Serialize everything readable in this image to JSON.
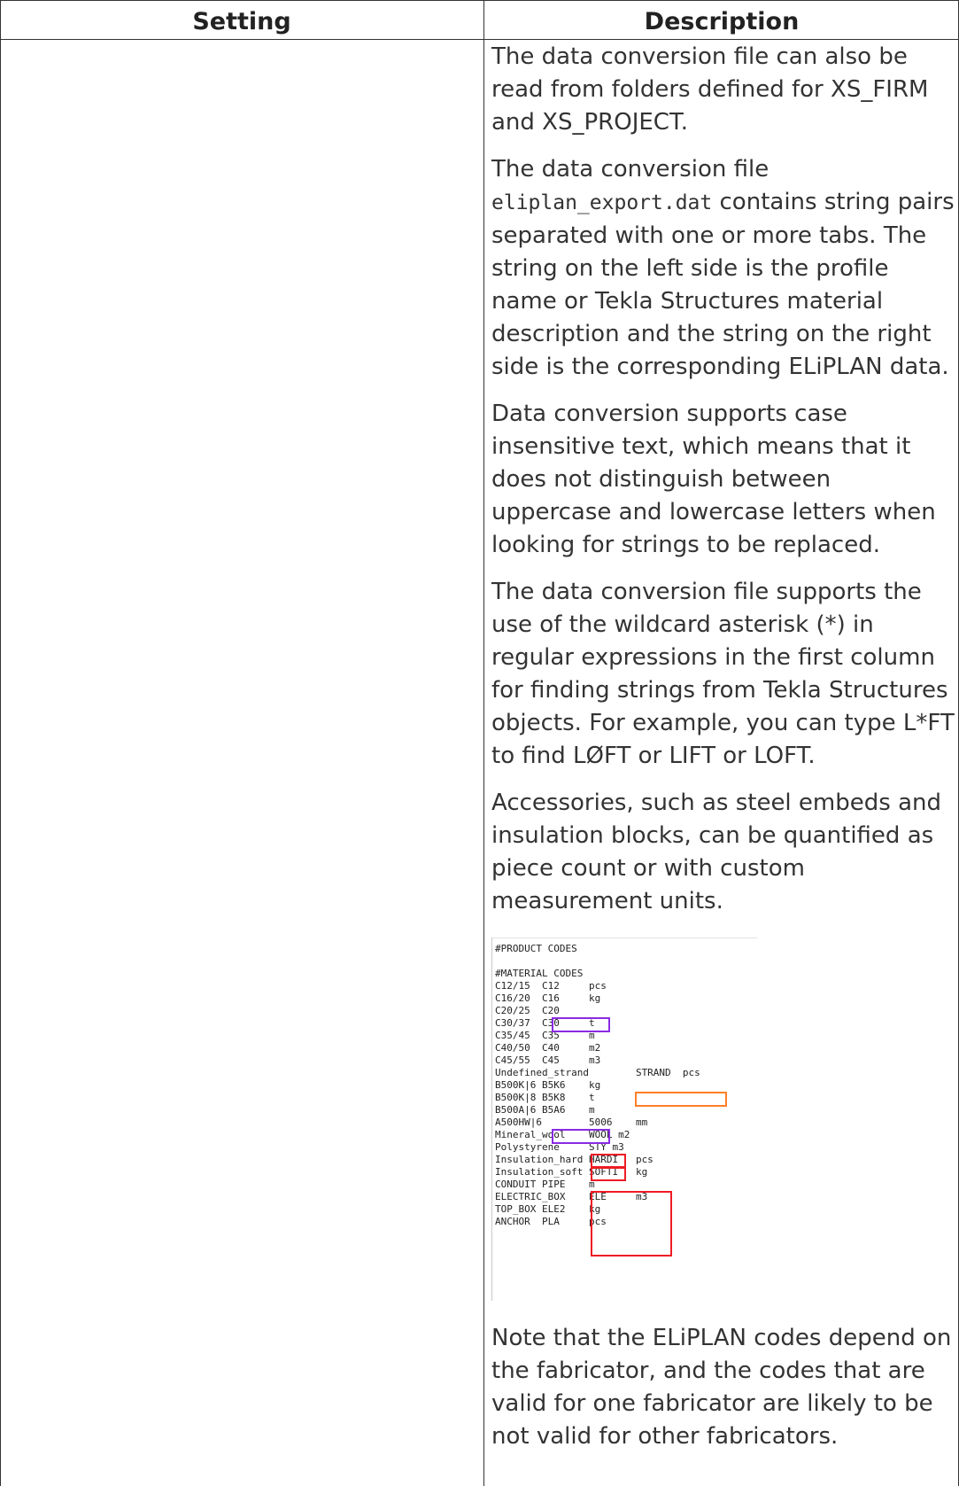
{
  "table": {
    "headers": {
      "setting": "Setting",
      "description": "Description"
    }
  },
  "description": {
    "p1": "The data conversion file can also be read from folders defined for XS_FIRM and XS_PROJECT.",
    "p2_before": "The data conversion file ",
    "p2_code": "eliplan_export.dat",
    "p2_after": " contains string pairs separated with one or more tabs. The string on the left side is the profile name or Tekla Structures material description and the string on the right side is the corresponding ELiPLAN data.",
    "p3": "Data conversion supports case insensitive text, which means that it does not distinguish between uppercase and lowercase letters when looking for strings to be replaced.",
    "p4": "The data conversion file supports the use of the wildcard asterisk (*) in regular expressions in the first column for finding strings from Tekla Structures objects. For example, you can type L*FT to find LØFT or LIFT or LOFT.",
    "p5": "Accessories, such as steel embeds and insulation blocks, can be quantified as piece count or with custom measurement units.",
    "p6": "Note that the ELiPLAN codes depend on the fabricator, and the codes that are valid for one fabricator are likely to be not valid for other fabricators."
  },
  "figure": {
    "lines": [
      "#PRODUCT CODES",
      "",
      "#MATERIAL CODES",
      "C12/15  C12     pcs",
      "C16/20  C16     kg",
      "C20/25  C20",
      "C30/37  C30     t",
      "C35/45  C35     m",
      "C40/50  C40     m2",
      "C45/55  C45     m3",
      "Undefined_strand        STRAND  pcs",
      "B500K|6 B5K6    kg",
      "B500K|8 B5K8    t",
      "B500A|6 B5A6    m",
      "A500HW|6        5006    mm",
      "Mineral_wool    WOOL m2",
      "Polystyrene     STY m3",
      "Insulation_hard HARDI   pcs",
      "Insulation_soft SOFTI   kg",
      "CONDUIT PIPE    m",
      "ELECTRIC_BOX    ELE     m3",
      "TOP_BOX ELE2    kg",
      "ANCHOR  PLA     pcs"
    ],
    "colors": {
      "purple": "#8a2be2",
      "orange": "#ff7f27",
      "red": "#ee1c24"
    }
  }
}
